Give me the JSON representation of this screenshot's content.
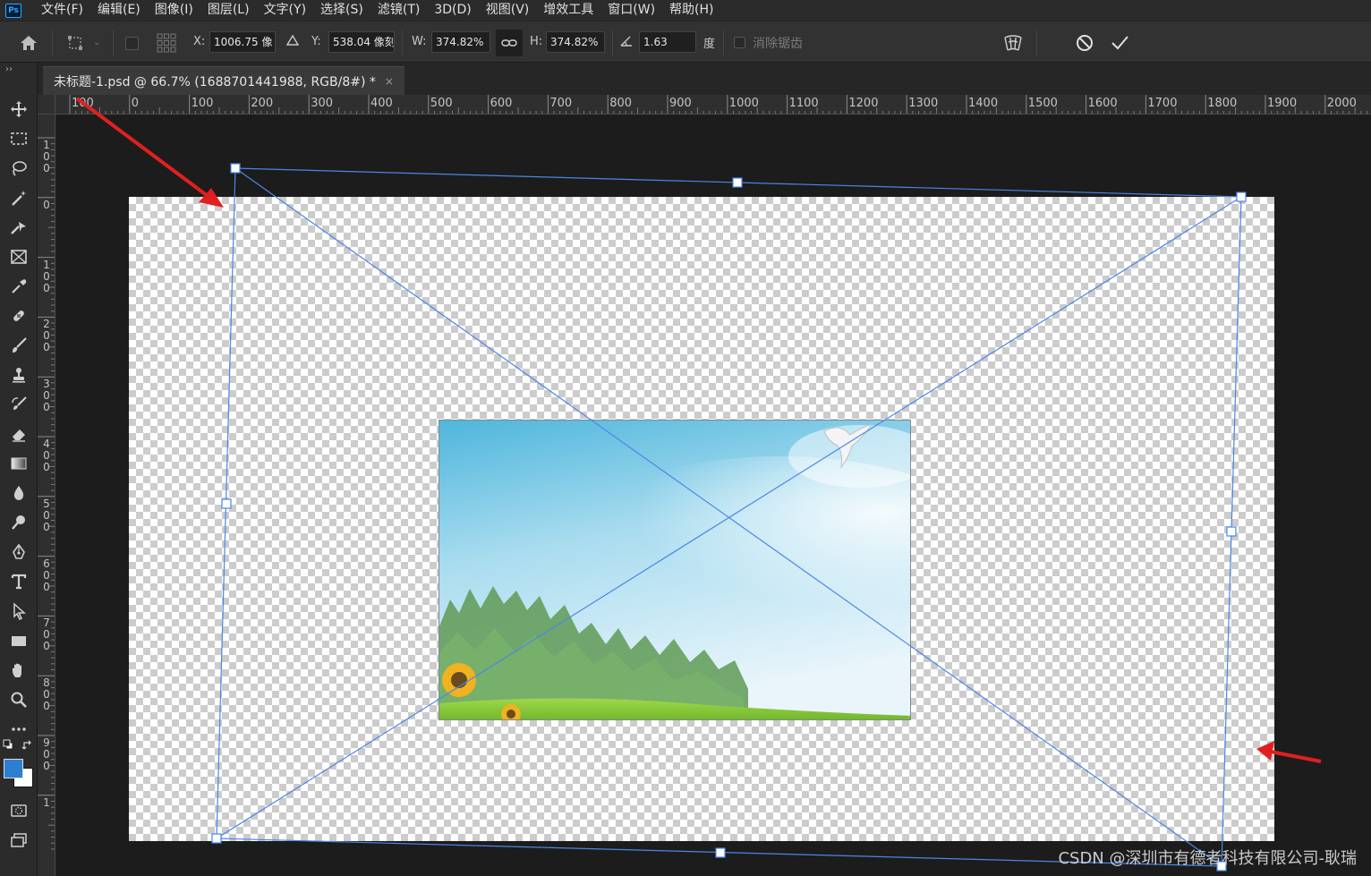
{
  "app": {
    "logo": "Ps"
  },
  "menu": [
    "文件(F)",
    "编辑(E)",
    "图像(I)",
    "图层(L)",
    "文字(Y)",
    "选择(S)",
    "滤镜(T)",
    "3D(D)",
    "视图(V)",
    "增效工具",
    "窗口(W)",
    "帮助(H)"
  ],
  "options": {
    "x_label": "X:",
    "x_value": "1006.75 像",
    "y_label": "Y:",
    "y_value": "538.04 像刻",
    "w_label": "W:",
    "w_value": "374.82%",
    "h_label": "H:",
    "h_value": "374.82%",
    "angle_value": "1.63",
    "angle_unit": "度",
    "antialias_label": "消除锯齿"
  },
  "tab": {
    "title": "未标题-1.psd @ 66.7% (1688701441988, RGB/8#) *",
    "close": "×"
  },
  "ruler_top": [
    "100",
    "0",
    "100",
    "200",
    "300",
    "400",
    "500",
    "600",
    "700",
    "800",
    "900",
    "1000",
    "1100",
    "1200",
    "1300",
    "1400",
    "1500",
    "1600",
    "1700",
    "1800",
    "1900",
    "2000"
  ],
  "ruler_left": [
    "100",
    "0",
    "100",
    "200",
    "300",
    "400",
    "500",
    "600",
    "700",
    "800",
    "900",
    "1"
  ],
  "colors": {
    "foreground": "#2f7fd0",
    "background": "#ffffff",
    "transform_box": "#4a86e8",
    "arrow": "#e02020"
  },
  "watermark": "CSDN @深圳市有德者科技有限公司-耿瑞"
}
